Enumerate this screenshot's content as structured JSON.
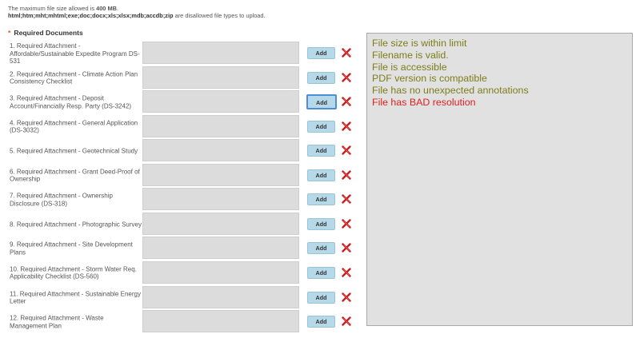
{
  "notice": {
    "line1_prefix": "The maximum file size allowed is ",
    "max_size": "400 MB",
    "line1_suffix": ".",
    "disallowed_types": "html;htm;mht;mhtml;exe;doc;docx;xls;xlsx;mdb;accdb;zip",
    "line2_suffix": " are disallowed file types to upload."
  },
  "section": {
    "marker": "*",
    "title": "Required Documents"
  },
  "add_label": "Add",
  "remove_icon": "red-x-delete-icon",
  "attachments": [
    {
      "label": "1. Required Attachment - Affordable/Sustainable Expedite Program DS-531"
    },
    {
      "label": "2. Required Attachment - Climate Action Plan Consistency Checklist"
    },
    {
      "label": "3. Required Attachment - Deposit Account/Financially Resp. Party (DS-3242)",
      "focused": true
    },
    {
      "label": "4. Required Attachment - General Application (DS-3032)"
    },
    {
      "label": "5. Required Attachment - Geotechnical Study"
    },
    {
      "label": "6. Required Attachment - Grant Deed-Proof of Ownership"
    },
    {
      "label": "7. Required Attachment - Ownership Disclosure (DS-318)"
    },
    {
      "label": "8. Required Attachment - Photographic Survey"
    },
    {
      "label": "9. Required Attachment - Site Development Plans"
    },
    {
      "label": "10. Required Attachment - Storm Water Req. Applicability Checklist (DS-560)"
    },
    {
      "label": "11. Required Attachment - Sustainable Energy Letter"
    },
    {
      "label": "12. Required Attachment - Waste Management Plan"
    }
  ],
  "validation": [
    {
      "text": "File size is within limit",
      "status": "ok"
    },
    {
      "text": "Filename is valid.",
      "status": "ok"
    },
    {
      "text": "File is accessible",
      "status": "ok"
    },
    {
      "text": "PDF version is compatible",
      "status": "ok"
    },
    {
      "text": "File has no unexpected annotations",
      "status": "ok"
    },
    {
      "text": "File has BAD resolution",
      "status": "bad"
    }
  ],
  "colors": {
    "ok": "#7d7d1a",
    "bad": "#e02020",
    "add_button": "#b5d9e9",
    "focus_ring": "#4c8ed8",
    "marker": "#e8551c"
  }
}
